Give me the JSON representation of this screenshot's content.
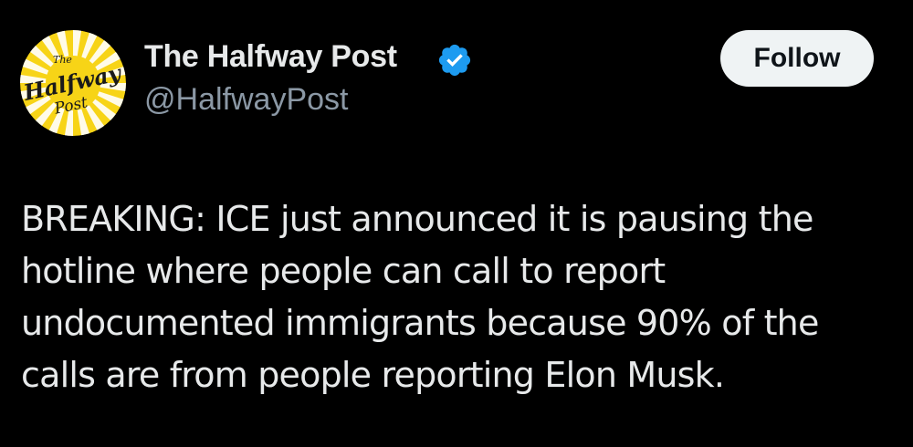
{
  "author": {
    "display_name": "The Halfway Post",
    "handle": "@HalfwayPost",
    "verified": true,
    "avatar": {
      "logo_text_top": "The",
      "logo_text_main": "Halfway",
      "logo_text_bottom": "Post",
      "colors": {
        "sun": "#f7d417",
        "rays": "#ffffff",
        "text": "#1a1a1a"
      }
    }
  },
  "follow_button": {
    "label": "Follow"
  },
  "tweet": {
    "lines": [
      "BREAKING: ICE just announced it is pausing the",
      "hotline where people can call to report",
      "undocumented immigrants because 90% of the",
      "calls are from people reporting Elon Musk."
    ]
  },
  "colors": {
    "background": "#000000",
    "text_primary": "#e7e9ea",
    "text_secondary": "#8b98a5",
    "verified_badge": "#1d9bf0",
    "button_bg": "#eff3f4",
    "button_text": "#0f1419"
  },
  "icons": {
    "verified": "verified-badge-icon"
  }
}
